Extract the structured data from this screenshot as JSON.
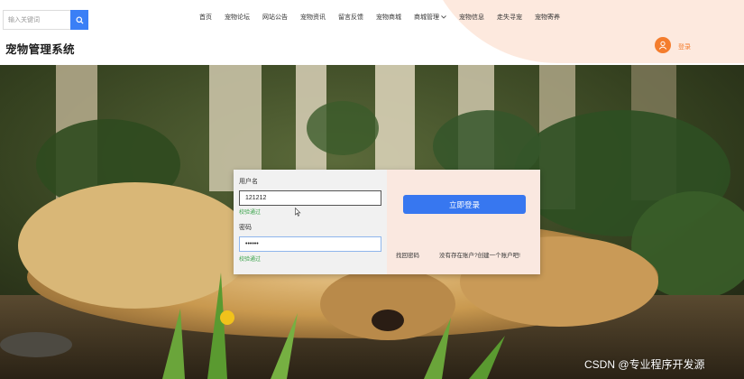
{
  "search": {
    "placeholder": "输入关键词",
    "value": ""
  },
  "nav": {
    "items": [
      {
        "label": "首页"
      },
      {
        "label": "宠物论坛"
      },
      {
        "label": "网站公告"
      },
      {
        "label": "宠物资讯"
      },
      {
        "label": "留言反馈"
      },
      {
        "label": "宠物商城"
      },
      {
        "label": "商城管理",
        "dropdown": true
      },
      {
        "label": "宠物信息"
      },
      {
        "label": "走失寻宠"
      },
      {
        "label": "宠物寄养"
      }
    ]
  },
  "brand": {
    "title": "宠物管理系统"
  },
  "user": {
    "login_label": "登录",
    "avatar_icon": "user-icon"
  },
  "login_form": {
    "username_label": "用户名",
    "username_value": "121212",
    "username_status": "校验通过",
    "password_label": "密码",
    "password_value": "••••••",
    "password_status": "校验通过",
    "submit_label": "立即登录",
    "forgot_label": "找回密码",
    "register_label": "没有存在账户?创建一个账户吧!"
  },
  "colors": {
    "accent": "#3777f0",
    "brand_orange": "#f47d2d",
    "valid_green": "#3aa34a",
    "header_blob": "#fde9de"
  },
  "watermark": "CSDN @专业程序开发源"
}
